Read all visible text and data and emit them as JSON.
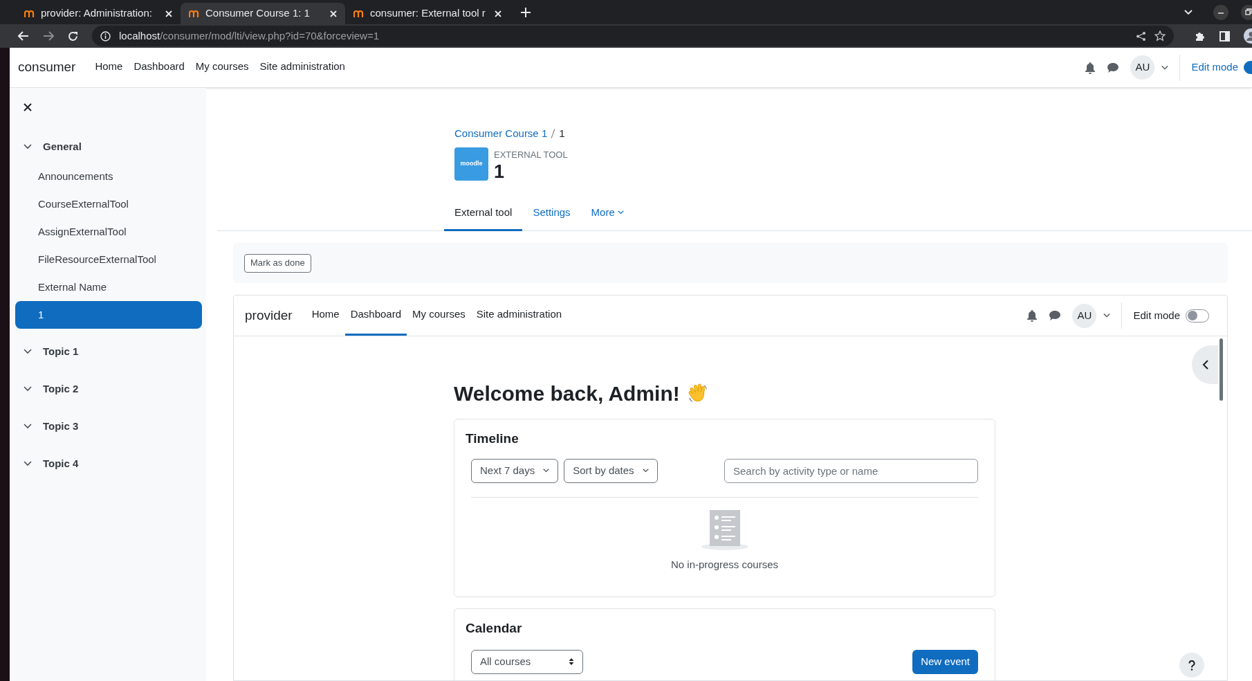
{
  "browser": {
    "tabs": [
      {
        "title": "provider: Administration:",
        "selected": false
      },
      {
        "title": "Consumer Course 1: 1",
        "selected": true
      },
      {
        "title": "consumer: External tool r",
        "selected": false
      }
    ],
    "url": {
      "host": "localhost",
      "path": "/consumer/mod/lti/view.php?id=70&forceview=1"
    }
  },
  "consumer": {
    "site_name": "consumer",
    "nav": [
      {
        "label": "Home",
        "selected": false
      },
      {
        "label": "Dashboard",
        "selected": false
      },
      {
        "label": "My courses",
        "selected": false
      },
      {
        "label": "Site administration",
        "selected": false
      }
    ],
    "user_initials": "AU",
    "edit_mode": {
      "label": "Edit mode",
      "on": true
    }
  },
  "sidebar": {
    "sections": [
      {
        "title": "General",
        "expanded": true,
        "children": [
          {
            "label": "Announcements",
            "selected": false
          },
          {
            "label": "CourseExternalTool",
            "selected": false
          },
          {
            "label": "AssignExternalTool",
            "selected": false
          },
          {
            "label": "FileResourceExternalTool",
            "selected": false
          },
          {
            "label": "External Name",
            "selected": false
          },
          {
            "label": "1",
            "selected": true
          }
        ]
      },
      {
        "title": "Topic 1",
        "expanded": true
      },
      {
        "title": "Topic 2",
        "expanded": true
      },
      {
        "title": "Topic 3",
        "expanded": true
      },
      {
        "title": "Topic 4",
        "expanded": true
      }
    ]
  },
  "breadcrumb": [
    {
      "label": "Consumer Course 1",
      "kind": "link"
    },
    {
      "label": "1",
      "kind": "current"
    }
  ],
  "activity": {
    "icon_label": "moodle",
    "type_label": "EXTERNAL TOOL",
    "title": "1"
  },
  "tabs": [
    {
      "label": "External tool",
      "selected": true,
      "dropdown": false
    },
    {
      "label": "Settings",
      "selected": false,
      "dropdown": false
    },
    {
      "label": "More",
      "selected": false,
      "dropdown": true
    }
  ],
  "completion_button": "Mark as done",
  "provider": {
    "site_name": "provider",
    "nav": [
      {
        "label": "Home",
        "selected": false
      },
      {
        "label": "Dashboard",
        "selected": true
      },
      {
        "label": "My courses",
        "selected": false
      },
      {
        "label": "Site administration",
        "selected": false
      }
    ],
    "user_initials": "AU",
    "edit_mode": {
      "label": "Edit mode",
      "on": false
    },
    "greeting": "Welcome back, Admin!",
    "timeline": {
      "title": "Timeline",
      "filters": [
        "Next 7 days",
        "Sort by dates"
      ],
      "search_placeholder": "Search by activity type or name",
      "empty_text": "No in-progress courses"
    },
    "calendar": {
      "title": "Calendar",
      "course_select": "All courses",
      "new_event": "New event"
    }
  }
}
